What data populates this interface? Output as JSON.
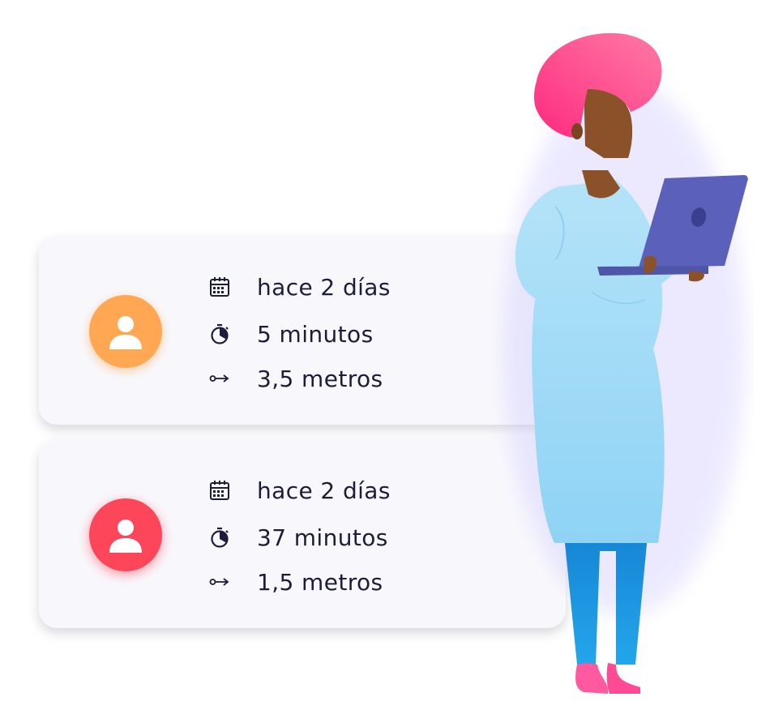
{
  "cards": [
    {
      "avatar_color": "#ffa752",
      "date": "hace 2 días",
      "duration": "5 minutos",
      "distance": "3,5 metros"
    },
    {
      "avatar_color": "#fd4659",
      "date": "hace 2 días",
      "duration": "37 minutos",
      "distance": "1,5 metros"
    }
  ],
  "icons": {
    "avatar": "person-icon",
    "date": "calendar-icon",
    "duration": "stopwatch-icon",
    "distance": "distance-arrow-icon"
  },
  "colors": {
    "text": "#1d1c3a",
    "card_background": "#f8f8fc",
    "hair": "#ff3d85",
    "skin": "#8b5128",
    "gown": "#a3dcf7",
    "pants": "#1e9ae4",
    "laptop": "#5b61ba",
    "shoes": "#ff5aa0"
  }
}
